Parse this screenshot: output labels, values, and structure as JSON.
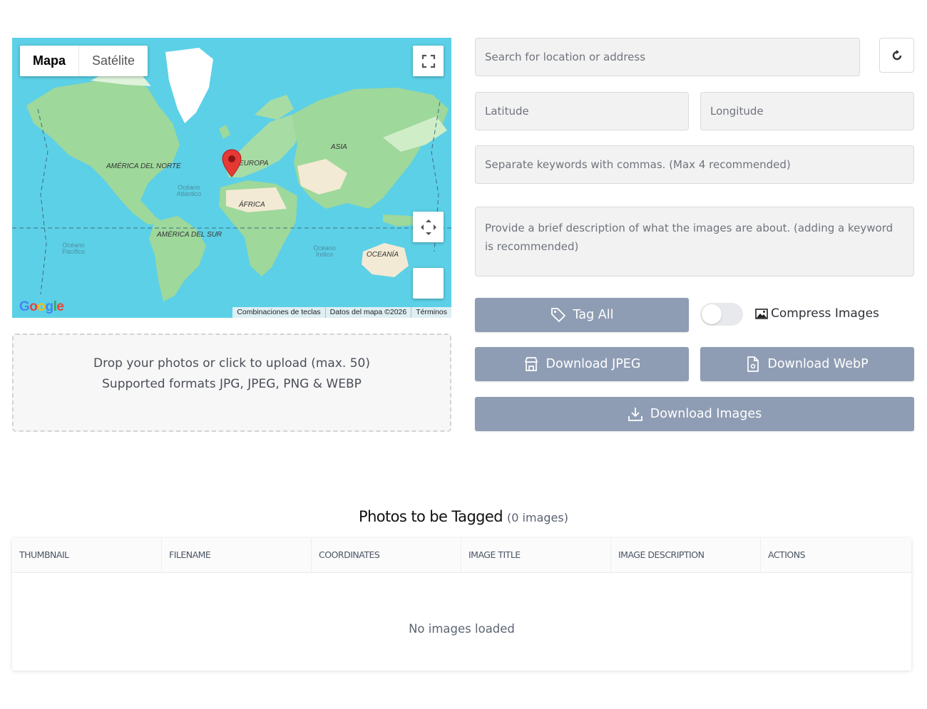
{
  "map": {
    "type_options": [
      "Mapa",
      "Satélite"
    ],
    "active_type": "Mapa",
    "labels": {
      "north_america": "AMÉRICA DEL NORTE",
      "south_america": "AMÉRICA DEL SUR",
      "europe": "EUROPA",
      "asia": "ASIA",
      "africa": "ÁFRICA",
      "oceania": "OCEANÍA",
      "atlantic": "Océano Atlántico",
      "pacific": "Océano Pacífico",
      "indian": "Océano Índico"
    },
    "footer": {
      "shortcuts": "Combinaciones de teclas",
      "map_data": "Datos del mapa ©2026",
      "terms": "Términos"
    },
    "google_logo": "Google",
    "colors": {
      "ocean": "#5cd0e6",
      "land": "#9ed89b",
      "marker": "#e53935"
    }
  },
  "dropzone": {
    "line1": "Drop your photos or click to upload (max. 50)",
    "line2": "Supported formats JPG, JPEG, PNG & WEBP"
  },
  "form": {
    "search_placeholder": "Search for location or address",
    "latitude_placeholder": "Latitude",
    "longitude_placeholder": "Longitude",
    "keywords_placeholder": "Separate keywords with commas. (Max 4 recommended)",
    "description_placeholder": "Provide a brief description of what the images are about. (adding a keyword is recommended)",
    "refresh_icon": "refresh-icon"
  },
  "actions": {
    "tag_all": "Tag All",
    "compress_label": "Compress Images",
    "compress_enabled": false,
    "download_jpeg": "Download JPEG",
    "download_webp": "Download WebP",
    "download_images": "Download Images",
    "button_color": "#8f9db4"
  },
  "table": {
    "title": "Photos to be Tagged",
    "count": "(0 images)",
    "columns": [
      "THUMBNAIL",
      "FILENAME",
      "COORDINATES",
      "IMAGE TITLE",
      "IMAGE DESCRIPTION",
      "ACTIONS"
    ],
    "empty_text": "No images loaded"
  }
}
